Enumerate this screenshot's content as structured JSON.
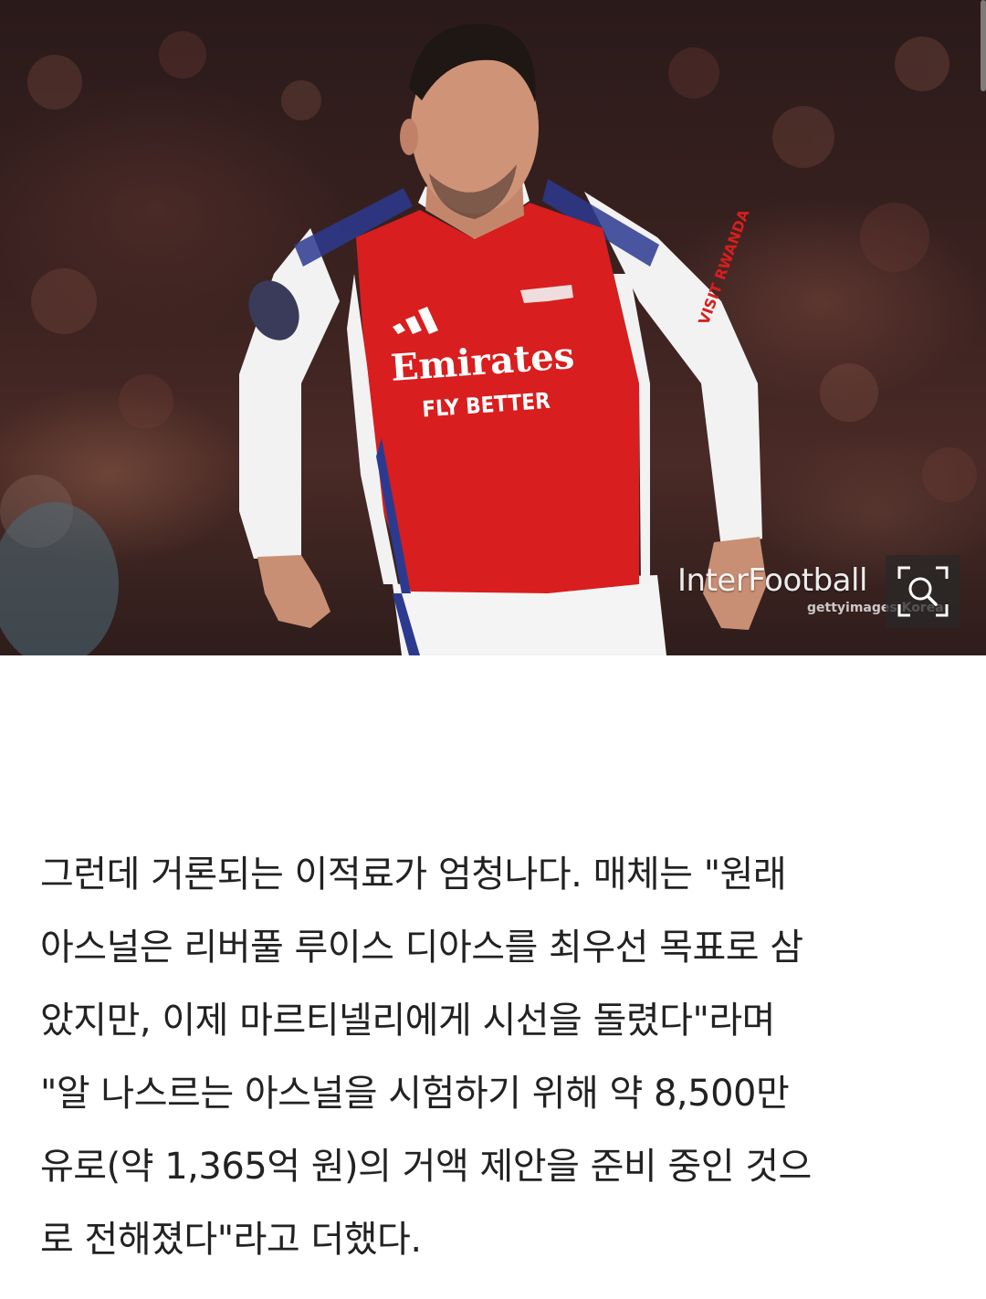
{
  "photo": {
    "alt": "",
    "shirt_sponsor_main": "Emirates",
    "shirt_sponsor_sub": "FLY BETTER",
    "sleeve_sponsor": "VISIT RWANDA",
    "watermark_logo": "InterFootball",
    "watermark_sub": "gettyimages Korea",
    "zoom_icon": "zoom-expand-icon"
  },
  "article": {
    "lines": [
      "그런데 거론되는 이적료가 엄청나다. 매체는 \"원래",
      "아스널은 리버풀 루이스 디아스를 최우선 목표로 삼",
      "았지만, 이제 마르티넬리에게 시선을 돌렸다\"라며",
      "\"알 나스르는 아스널을 시험하기 위해 약 8,500만",
      "유로(약 1,365억 원)의 거액 제안을 준비 중인 것으",
      "로 전해졌다\"라고 더했다."
    ]
  },
  "colors": {
    "text": "#222222",
    "background": "#ffffff",
    "arsenal_red": "#d81e1e",
    "arsenal_blue": "#2b3a8f"
  }
}
